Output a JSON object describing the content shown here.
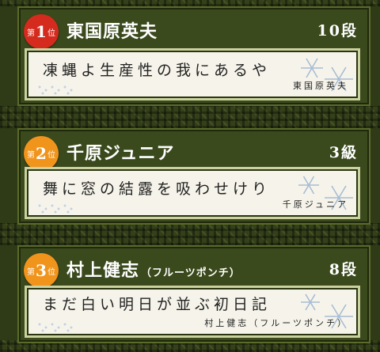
{
  "entries": [
    {
      "rank_prefix": "第",
      "rank_number": "1",
      "rank_suffix": "位",
      "badge_color": "#d42b1e",
      "name": "東国原英夫",
      "name_suffix": "",
      "grade": "10段",
      "haiku": "凍蝿よ生産性の我にあるや",
      "author": "東国原英夫",
      "icon": "snowflake-icon"
    },
    {
      "rank_prefix": "第",
      "rank_number": "2",
      "rank_suffix": "位",
      "badge_color": "#f0941c",
      "name": "千原ジュニア",
      "name_suffix": "",
      "grade": "3級",
      "haiku": "舞に窓の結露を吸わせけり",
      "author": "千原ジュニア",
      "icon": "snowflake-icon"
    },
    {
      "rank_prefix": "第",
      "rank_number": "3",
      "rank_suffix": "位",
      "badge_color": "#f0941c",
      "name": "村上健志",
      "name_suffix": "（フルーツポンチ）",
      "grade": "8段",
      "haiku": "まだ白い明日が並ぶ初日記",
      "author": "村上健志（フルーツポンチ）",
      "icon": "snowflake-icon"
    }
  ]
}
